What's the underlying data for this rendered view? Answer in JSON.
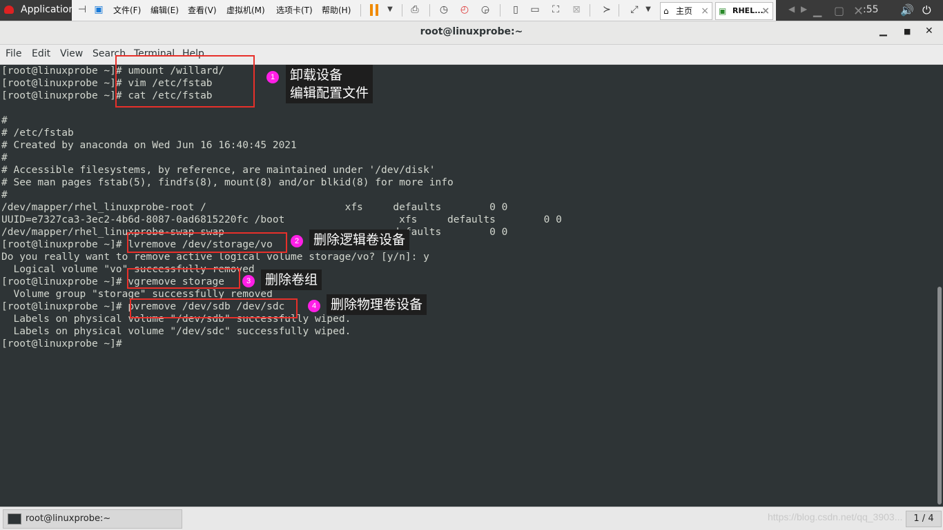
{
  "gnome": {
    "apps_label": "Application",
    "clock": ":55"
  },
  "vmware": {
    "menus": [
      "文件(F)",
      "编辑(E)",
      "查看(V)",
      "虚拟机(M)",
      "选项卡(T)",
      "帮助(H)"
    ],
    "tabs": [
      {
        "label": "主页"
      },
      {
        "label": "RHEL..."
      }
    ]
  },
  "window": {
    "title": "root@linuxprobe:~"
  },
  "menubar": [
    "File",
    "Edit",
    "View",
    "Search",
    "Terminal",
    "Help"
  ],
  "terminal": {
    "lines": [
      "[root@linuxprobe ~]# umount /willard/",
      "[root@linuxprobe ~]# vim /etc/fstab",
      "[root@linuxprobe ~]# cat /etc/fstab",
      "",
      "#",
      "# /etc/fstab",
      "# Created by anaconda on Wed Jun 16 16:40:45 2021",
      "#",
      "# Accessible filesystems, by reference, are maintained under '/dev/disk'",
      "# See man pages fstab(5), findfs(8), mount(8) and/or blkid(8) for more info",
      "#",
      "/dev/mapper/rhel_linuxprobe-root /                       xfs     defaults        0 0",
      "UUID=e7327ca3-3ec2-4b6d-8087-0ad6815220fc /boot                   xfs     defaults        0 0",
      "/dev/mapper/rhel_linuxprobe-swap swap                    swap    defaults        0 0",
      "[root@linuxprobe ~]# lvremove /dev/storage/vo",
      "Do you really want to remove active logical volume storage/vo? [y/n]: y",
      "  Logical volume \"vo\" successfully removed",
      "[root@linuxprobe ~]# vgremove storage",
      "  Volume group \"storage\" successfully removed",
      "[root@linuxprobe ~]# pvremove /dev/sdb /dev/sdc",
      "  Labels on physical volume \"/dev/sdb\" successfully wiped.",
      "  Labels on physical volume \"/dev/sdc\" successfully wiped.",
      "[root@linuxprobe ~]#"
    ]
  },
  "annotations": [
    {
      "num": "1",
      "text_line1": "卸载设备",
      "text_line2": "编辑配置文件"
    },
    {
      "num": "2",
      "text": "删除逻辑卷设备"
    },
    {
      "num": "3",
      "text": "删除卷组"
    },
    {
      "num": "4",
      "text": "删除物理卷设备"
    }
  ],
  "taskbar": {
    "task_label": "root@linuxprobe:~",
    "pager": "1 / 4"
  },
  "watermark": "https://blog.csdn.net/qq_3903..."
}
